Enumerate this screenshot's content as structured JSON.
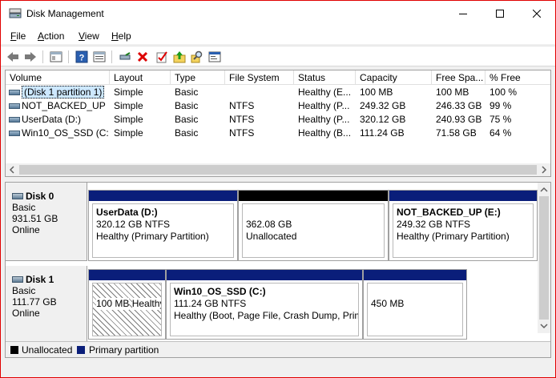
{
  "window": {
    "title": "Disk Management",
    "minimize_icon": "minimize-icon",
    "maximize_icon": "maximize-icon",
    "close_icon": "close-icon"
  },
  "menu": {
    "file": "File",
    "action": "Action",
    "view": "View",
    "help": "Help"
  },
  "toolbar": {
    "icons": [
      "back-arrow-icon",
      "forward-arrow-icon",
      "console-tree-icon",
      "help-icon",
      "properties-icon",
      "connect-icon",
      "delete-icon",
      "check-icon",
      "rescan-icon",
      "search-icon",
      "format-icon"
    ]
  },
  "volume_list": {
    "columns": [
      "Volume",
      "Layout",
      "Type",
      "File System",
      "Status",
      "Capacity",
      "Free Spa...",
      "% Free"
    ],
    "rows": [
      [
        "(Disk 1 partition 1)",
        "Simple",
        "Basic",
        "",
        "Healthy (E...",
        "100 MB",
        "100 MB",
        "100 %"
      ],
      [
        "NOT_BACKED_UP ...",
        "Simple",
        "Basic",
        "NTFS",
        "Healthy (P...",
        "249.32 GB",
        "246.33 GB",
        "99 %"
      ],
      [
        "UserData (D:)",
        "Simple",
        "Basic",
        "NTFS",
        "Healthy (P...",
        "320.12 GB",
        "240.93 GB",
        "75 %"
      ],
      [
        "Win10_OS_SSD (C:)",
        "Simple",
        "Basic",
        "NTFS",
        "Healthy (B...",
        "111.24 GB",
        "71.58 GB",
        "64 %"
      ]
    ]
  },
  "disks": {
    "disk0": {
      "name": "Disk 0",
      "type": "Basic",
      "size": "931.51 GB",
      "status": "Online",
      "partitions": {
        "p1": {
          "name": "UserData  (D:)",
          "size": "320.12 GB NTFS",
          "status": "Healthy (Primary Partition)"
        },
        "p2": {
          "size": "362.08 GB",
          "status": "Unallocated"
        },
        "p3": {
          "name": "NOT_BACKED_UP  (E:)",
          "size": "249.32 GB NTFS",
          "status": "Healthy (Primary Partition)"
        }
      }
    },
    "disk1": {
      "name": "Disk 1",
      "type": "Basic",
      "size": "111.77 GB",
      "status": "Online",
      "partitions": {
        "p1": {
          "size": "100 MB",
          "status": "Healthy (EFI System Partition)"
        },
        "p2": {
          "name": "Win10_OS_SSD  (C:)",
          "size": "111.24 GB NTFS",
          "status": "Healthy (Boot, Page File, Crash Dump, Primary Partition)"
        },
        "p3": {
          "size": "450 MB"
        }
      }
    }
  },
  "legend": {
    "unallocated": "Unallocated",
    "primary": "Primary partition"
  },
  "colors": {
    "primary_partition": "#0a1e7a",
    "unallocated": "#000000",
    "window_border": "#e00000"
  }
}
